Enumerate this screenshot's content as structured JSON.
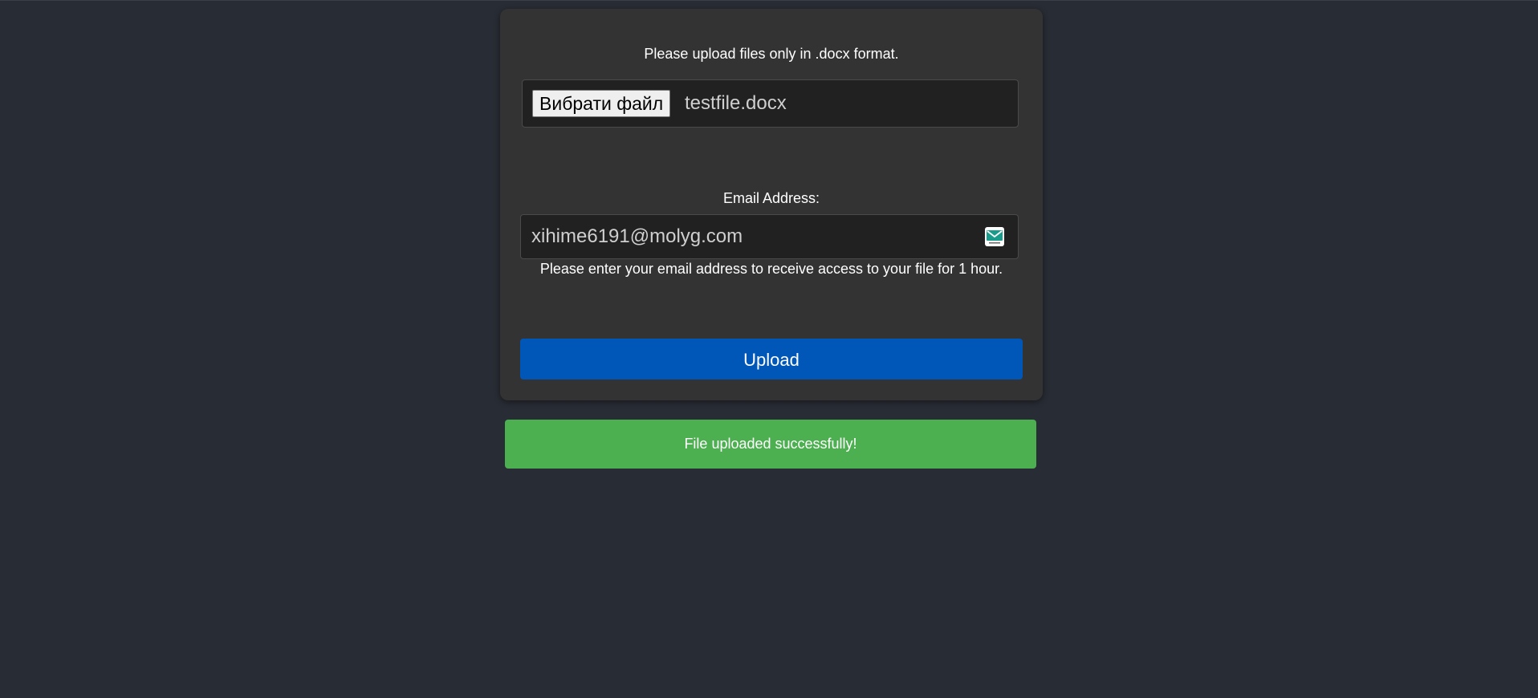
{
  "form": {
    "instruction": "Please upload files only in .docx format.",
    "file_button_label": "Вибрати файл",
    "file_name": "testfile.docx",
    "email_label": "Email Address:",
    "email_value": "xihime6191@molyg.com",
    "email_icon": "mail-icon",
    "email_help": "Please enter your email address to receive access to your file for 1 hour.",
    "upload_label": "Upload"
  },
  "status": {
    "message": "File uploaded successfully!"
  },
  "colors": {
    "background": "#282c34",
    "card": "#333333",
    "upload_button": "#0057b8",
    "success": "#4caf50"
  }
}
